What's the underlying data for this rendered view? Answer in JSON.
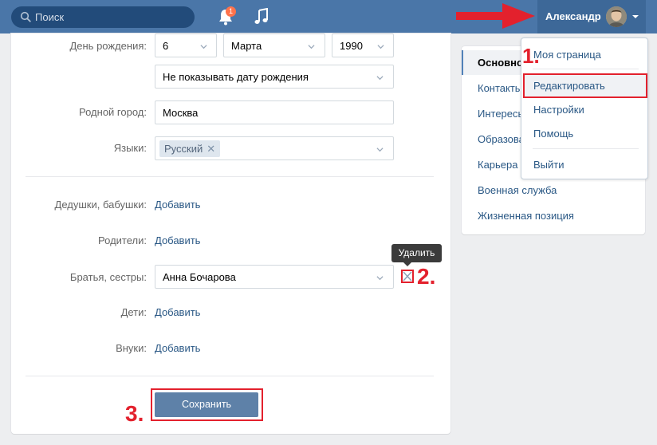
{
  "header": {
    "search_placeholder": "Поиск",
    "notification_count": "1",
    "user_name": "Александр"
  },
  "profile": {
    "birthday_label": "День рождения:",
    "birthday_day": "6",
    "birthday_month": "Марта",
    "birthday_year": "1990",
    "birthday_visibility": "Не показывать дату рождения",
    "hometown_label": "Родной город:",
    "hometown_value": "Москва",
    "languages_label": "Языки:",
    "language_tag": "Русский",
    "grandparents_label": "Дедушки, бабушки:",
    "grandparents_link": "Добавить",
    "parents_label": "Родители:",
    "parents_link": "Добавить",
    "siblings_label": "Братья, сестры:",
    "siblings_value": "Анна Бочарова",
    "children_label": "Дети:",
    "children_link": "Добавить",
    "grandchildren_label": "Внуки:",
    "grandchildren_link": "Добавить",
    "delete_tooltip": "Удалить",
    "save_label": "Сохранить"
  },
  "side_menu": {
    "items": [
      "Основное",
      "Контакты",
      "Интересы",
      "Образование",
      "Карьера",
      "Военная служба",
      "Жизненная позиция"
    ]
  },
  "user_dropdown": {
    "items": [
      "Моя страница",
      "Редактировать",
      "Настройки",
      "Помощь",
      "Выйти"
    ]
  },
  "annotations": {
    "step1": "1.",
    "step2": "2.",
    "step3": "3."
  },
  "colors": {
    "header_bg": "#4a76a8",
    "highlight_red": "#e3212d",
    "link_blue": "#2a5885",
    "button_bg": "#5e81a8"
  }
}
